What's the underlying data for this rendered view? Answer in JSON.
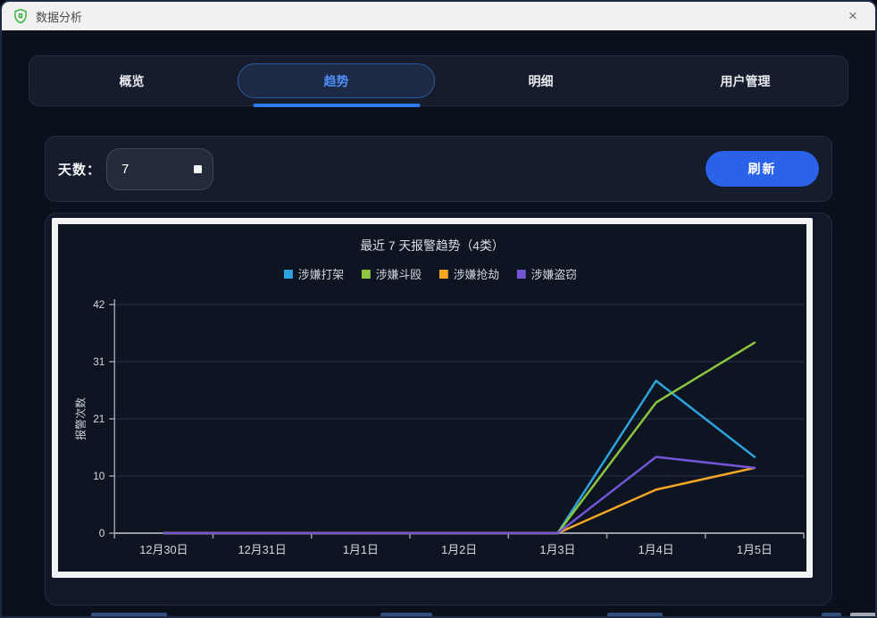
{
  "window": {
    "title": "数据分析",
    "close_label": "×"
  },
  "tabs": [
    {
      "label": "概览"
    },
    {
      "label": "趋势"
    },
    {
      "label": "明细"
    },
    {
      "label": "用户管理"
    }
  ],
  "controls": {
    "days_label": "天数：",
    "days_value": "7",
    "refresh_label": "刷新"
  },
  "chart_data": {
    "type": "line",
    "title": "最近 7 天报警趋势（4类）",
    "ylabel": "报警次数",
    "categories": [
      "12月30日",
      "12月31日",
      "1月1日",
      "1月2日",
      "1月3日",
      "1月4日",
      "1月5日"
    ],
    "series": [
      {
        "name": "涉嫌打架",
        "color": "#2ea2dd",
        "values": [
          0,
          0,
          0,
          0,
          0,
          28,
          14
        ]
      },
      {
        "name": "涉嫌斗殴",
        "color": "#8dc63f",
        "values": [
          0,
          0,
          0,
          0,
          0,
          24,
          35
        ]
      },
      {
        "name": "涉嫌抢劫",
        "color": "#f5a623",
        "values": [
          0,
          0,
          0,
          0,
          0,
          8,
          12
        ]
      },
      {
        "name": "涉嫌盗窃",
        "color": "#7355d6",
        "values": [
          0,
          0,
          0,
          0,
          0,
          14,
          12
        ]
      }
    ],
    "ylim": [
      0,
      42
    ],
    "yticks": [
      0,
      10.5,
      21,
      31.5,
      42
    ],
    "ytick_labels": [
      "0",
      "10",
      "21",
      "31",
      "42"
    ],
    "grid": true,
    "legend_position": "top",
    "axis_color": "#9a9ea6",
    "grid_color": "#273246",
    "text_color": "#d6d9de"
  }
}
